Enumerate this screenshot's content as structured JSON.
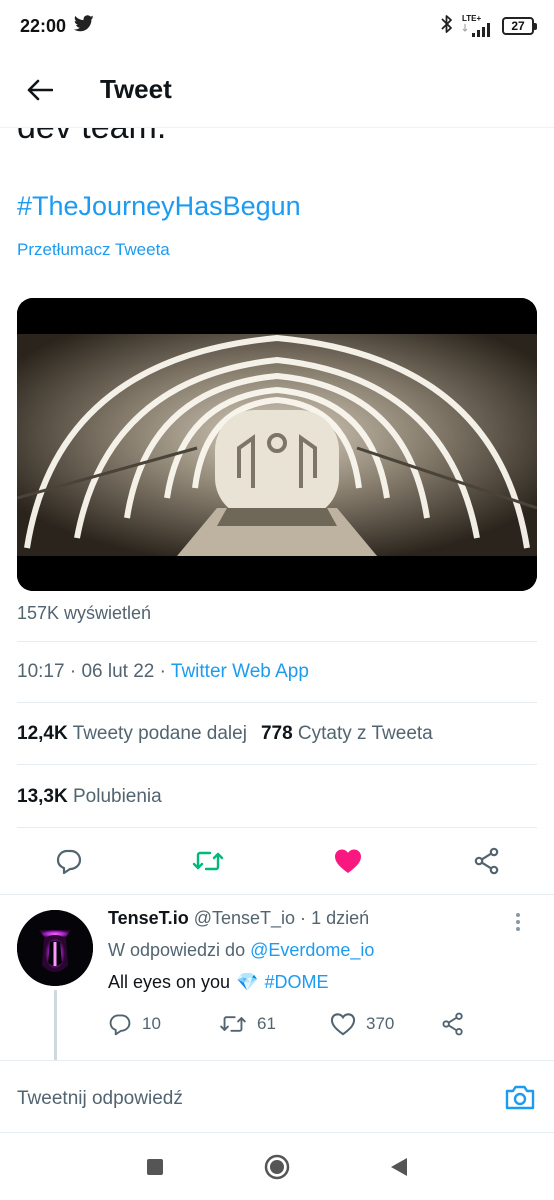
{
  "status_bar": {
    "time": "22:00",
    "network": "LTE+",
    "battery": "27",
    "icons": [
      "twitter-icon",
      "bluetooth-icon",
      "signal-icon",
      "battery-icon"
    ]
  },
  "header": {
    "title": "Tweet",
    "back_icon": "arrow-left-icon"
  },
  "tweet": {
    "clipped_text": "dev team.",
    "hashtag": "#TheJourneyHasBegun",
    "translate_link": "Przetłumacz Tweeta",
    "views": "157K wyświetleń",
    "time": "10:17",
    "date": "06 lut 22",
    "separator": "·",
    "source_app": "Twitter Web App",
    "retweets_count": "12,4K",
    "retweets_label": "Tweety podane dalej",
    "quotes_count": "778",
    "quotes_label": "Cytaty z Tweeta",
    "likes_count": "13,3K",
    "likes_label": "Polubienia",
    "liked": true,
    "colors": {
      "accent": "#1d9bf0",
      "retweet": "#00ba7c",
      "like": "#f91880"
    }
  },
  "reply": {
    "name": "TenseT.io",
    "handle": "@TenseT_io",
    "separator": "·",
    "time": "1 dzień",
    "reply_prefix": "W odpowiedzi do",
    "reply_to_handle": "@Everdome_io",
    "text": "All eyes on you",
    "emoji": "💎",
    "tag": "#DOME",
    "replies": "10",
    "retweets": "61",
    "likes": "370"
  },
  "compose": {
    "placeholder": "Tweetnij odpowiedź"
  }
}
